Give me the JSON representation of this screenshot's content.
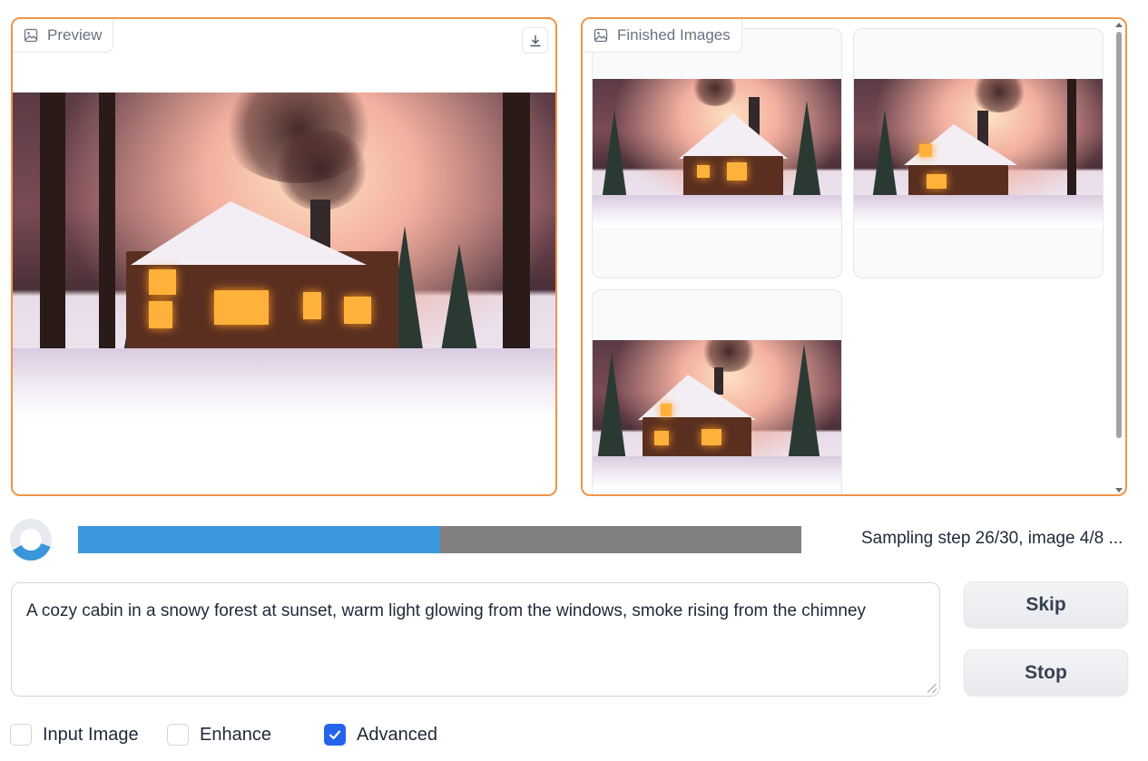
{
  "preview_panel": {
    "label": "Preview",
    "label_icon": "image-icon",
    "download_icon": "download-icon"
  },
  "finished_panel": {
    "label": "Finished Images",
    "label_icon": "image-icon",
    "thumbnail_count": 3
  },
  "progress": {
    "text": "Sampling step 26/30, image 4/8 ...",
    "fraction": 0.5,
    "fill_color": "#3a97db",
    "track_color": "#808080"
  },
  "prompt": {
    "value": "A cozy cabin in a snowy forest at sunset, warm light glowing from the windows, smoke rising from the chimney"
  },
  "buttons": {
    "skip": "Skip",
    "stop": "Stop"
  },
  "options": {
    "input_image": {
      "label": "Input Image",
      "checked": false
    },
    "enhance": {
      "label": "Enhance",
      "checked": false
    },
    "advanced": {
      "label": "Advanced",
      "checked": true
    }
  },
  "colors": {
    "panel_border": "#f0944a",
    "checkbox_checked": "#2563eb"
  }
}
